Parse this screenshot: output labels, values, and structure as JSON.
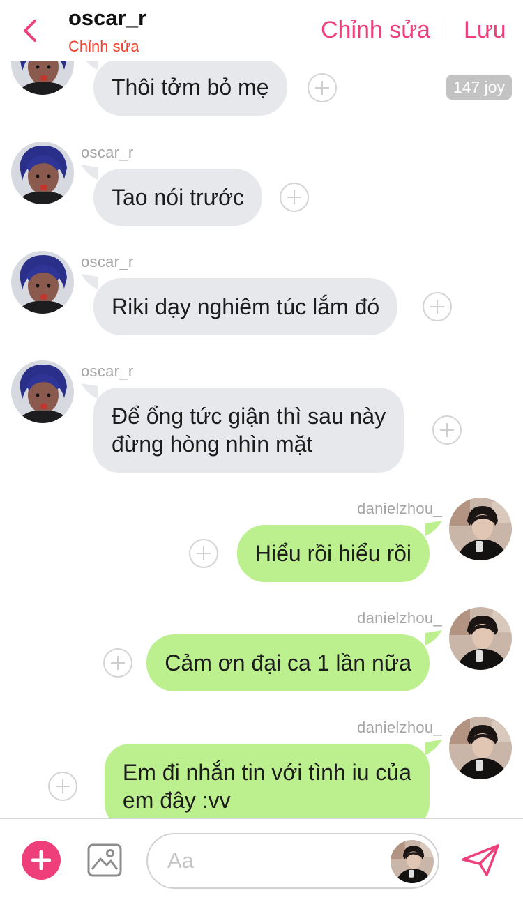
{
  "header": {
    "title": "oscar_r",
    "subtitle": "Chỉnh sửa",
    "edit_label": "Chỉnh sửa",
    "save_label": "Lưu"
  },
  "joy_badge": "147 joy",
  "messages": [
    {
      "sender": "oscar_r",
      "side": "left",
      "lines": [
        "Thôi tởm bỏ mẹ"
      ]
    },
    {
      "sender": "oscar_r",
      "side": "left",
      "lines": [
        "Tao nói trước"
      ]
    },
    {
      "sender": "oscar_r",
      "side": "left",
      "lines": [
        "Riki dạy nghiêm túc lắm đó"
      ]
    },
    {
      "sender": "oscar_r",
      "side": "left",
      "lines": [
        "Để ổng tức giận thì sau này",
        "đừng hòng nhìn mặt"
      ]
    },
    {
      "sender": "danielzhou_",
      "side": "right",
      "lines": [
        "Hiểu rồi hiểu rồi"
      ]
    },
    {
      "sender": "danielzhou_",
      "side": "right",
      "lines": [
        "Cảm ơn đại ca 1 lần nữa"
      ]
    },
    {
      "sender": "danielzhou_",
      "side": "right",
      "lines": [
        "Em đi nhắn tin với tình iu của",
        "em đây :vv"
      ]
    }
  ],
  "composer": {
    "placeholder": "Aa"
  },
  "icons": {
    "back": "chevron-left-icon",
    "add": "plus-circle-icon",
    "image": "image-icon",
    "send": "send-icon",
    "react": "plus-outline-icon"
  },
  "colors": {
    "accent": "#ee3f7b",
    "subtitle": "#f2402c",
    "incoming_bubble": "#e6e8ec",
    "outgoing_bubble": "#bcef8e"
  }
}
